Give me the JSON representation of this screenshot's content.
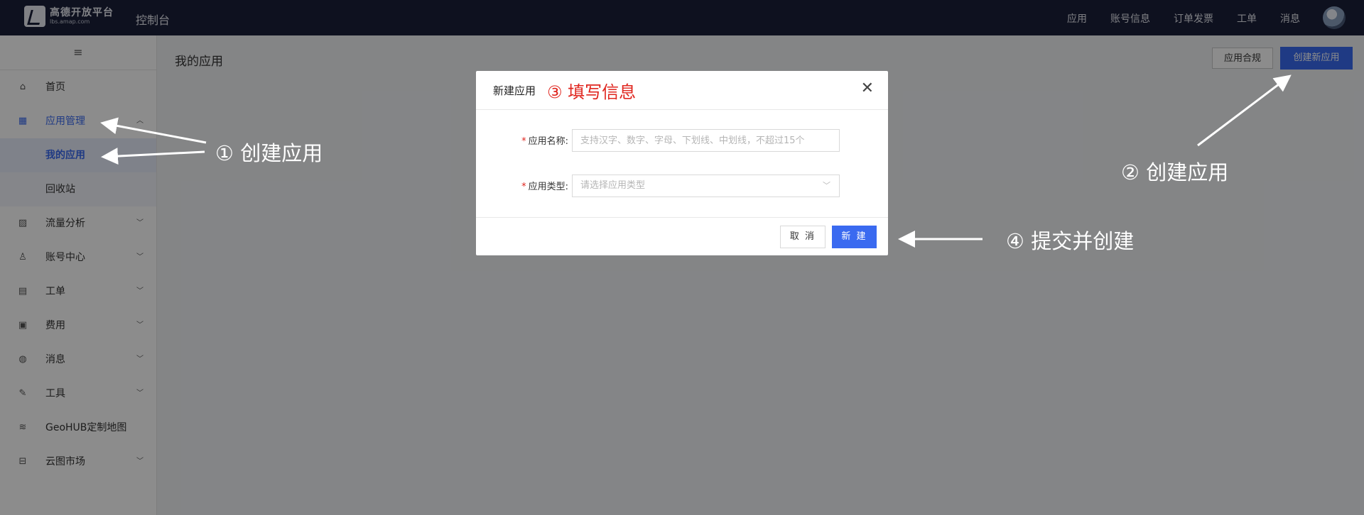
{
  "topbar": {
    "logo_name": "高德开放平台",
    "logo_url": "lbs.amap.com",
    "console_label": "控制台",
    "nav": [
      "应用",
      "账号信息",
      "订单发票",
      "工单",
      "消息"
    ]
  },
  "sidebar": {
    "collapse_icon": "≡",
    "items": [
      {
        "label": "首页",
        "icon": "home-icon",
        "glyph": "⌂"
      },
      {
        "label": "应用管理",
        "icon": "grid-icon",
        "glyph": "▦",
        "expanded": true
      },
      {
        "label": "我的应用"
      },
      {
        "label": "回收站"
      },
      {
        "label": "流量分析",
        "icon": "chart-icon",
        "glyph": "▨"
      },
      {
        "label": "账号中心",
        "icon": "user-icon",
        "glyph": "♙"
      },
      {
        "label": "工单",
        "icon": "ticket-icon",
        "glyph": "▤"
      },
      {
        "label": "费用",
        "icon": "fee-icon",
        "glyph": "▣"
      },
      {
        "label": "消息",
        "icon": "message-icon",
        "glyph": "◍"
      },
      {
        "label": "工具",
        "icon": "wrench-icon",
        "glyph": "✎"
      },
      {
        "label": "GeoHUB定制地图",
        "icon": "layers-icon",
        "glyph": "≋"
      },
      {
        "label": "云图市场",
        "icon": "store-icon",
        "glyph": "⊟"
      }
    ]
  },
  "main": {
    "title": "我的应用",
    "compliance_button": "应用合规",
    "create_button": "创建新应用"
  },
  "modal": {
    "title": "新建应用",
    "annotation": "③ 填写信息",
    "close_glyph": "✕",
    "name_label": "应用名称:",
    "name_placeholder": "支持汉字、数字、字母、下划线、中划线，不超过15个",
    "type_label": "应用类型:",
    "type_placeholder": "请选择应用类型",
    "cancel_label": "取 消",
    "create_label": "新 建"
  },
  "annotations": {
    "step1": "① 创建应用",
    "step2": "② 创建应用",
    "step4": "④ 提交并创建"
  },
  "colors": {
    "topbar": "#1a1f3a",
    "primary": "#3a6af0",
    "annotation_red": "#e0261f"
  }
}
